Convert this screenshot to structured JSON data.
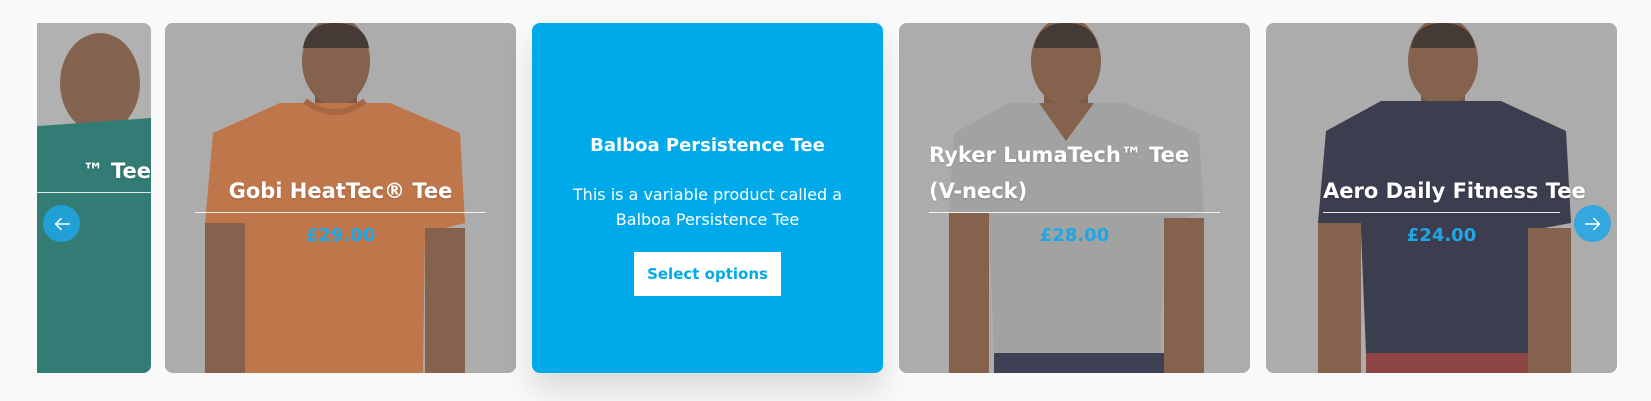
{
  "carousel": {
    "cards": [
      {
        "title": "™ Tee",
        "shirt_color": "#0f7f73"
      },
      {
        "title": "Gobi HeatTec® Tee",
        "price": "£29.00",
        "shirt_color": "#e57533"
      },
      {
        "title": "Balboa Persistence Tee",
        "description": "This is a variable product called a Balboa Persistence Tee",
        "button_label": "Select options"
      },
      {
        "title": "Ryker LumaTech™ Tee (V-neck)",
        "price": "£28.00",
        "shirt_color": "#b9b9b9"
      },
      {
        "title": "Aero Daily Fitness Tee",
        "price": "£24.00",
        "shirt_color": "#1c1f3b"
      }
    ],
    "prev_icon": "arrow-left-icon",
    "next_icon": "arrow-right-icon",
    "colors": {
      "accent": "#00a9e9",
      "price": "#1ea7e6",
      "card_bg": "#bdbdbd"
    }
  }
}
